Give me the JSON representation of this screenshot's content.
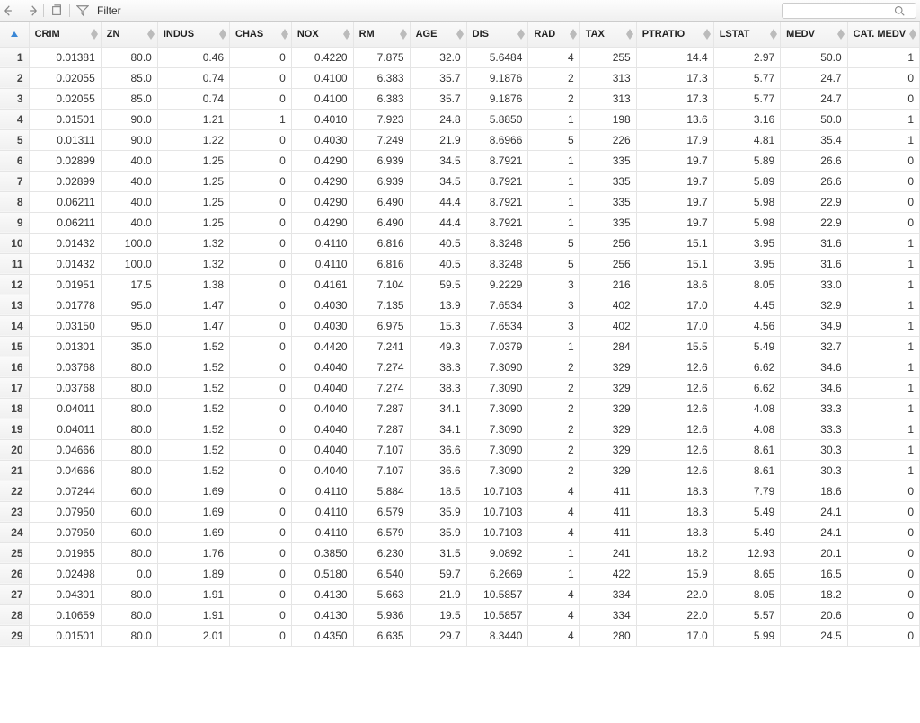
{
  "toolbar": {
    "filter_label": "Filter",
    "search_placeholder": ""
  },
  "columns": [
    {
      "key": "CRIM",
      "label": "CRIM",
      "cls": "col-crim"
    },
    {
      "key": "ZN",
      "label": "ZN",
      "cls": "col-zn"
    },
    {
      "key": "INDUS",
      "label": "INDUS",
      "cls": "col-indus"
    },
    {
      "key": "CHAS",
      "label": "CHAS",
      "cls": "col-chas"
    },
    {
      "key": "NOX",
      "label": "NOX",
      "cls": "col-nox"
    },
    {
      "key": "RM",
      "label": "RM",
      "cls": "col-rm"
    },
    {
      "key": "AGE",
      "label": "AGE",
      "cls": "col-age"
    },
    {
      "key": "DIS",
      "label": "DIS",
      "cls": "col-dis"
    },
    {
      "key": "RAD",
      "label": "RAD",
      "cls": "col-rad"
    },
    {
      "key": "TAX",
      "label": "TAX",
      "cls": "col-tax"
    },
    {
      "key": "PTRATIO",
      "label": "PTRATIO",
      "cls": "col-ptratio"
    },
    {
      "key": "LSTAT",
      "label": "LSTAT",
      "cls": "col-lstat"
    },
    {
      "key": "MEDV",
      "label": "MEDV",
      "cls": "col-medv"
    },
    {
      "key": "CAT_MEDV",
      "label": "CAT. MEDV",
      "cls": "col-cat"
    }
  ],
  "rows": [
    {
      "n": 1,
      "CRIM": "0.01381",
      "ZN": "80.0",
      "INDUS": "0.46",
      "CHAS": "0",
      "NOX": "0.4220",
      "RM": "7.875",
      "AGE": "32.0",
      "DIS": "5.6484",
      "RAD": "4",
      "TAX": "255",
      "PTRATIO": "14.4",
      "LSTAT": "2.97",
      "MEDV": "50.0",
      "CAT_MEDV": "1"
    },
    {
      "n": 2,
      "CRIM": "0.02055",
      "ZN": "85.0",
      "INDUS": "0.74",
      "CHAS": "0",
      "NOX": "0.4100",
      "RM": "6.383",
      "AGE": "35.7",
      "DIS": "9.1876",
      "RAD": "2",
      "TAX": "313",
      "PTRATIO": "17.3",
      "LSTAT": "5.77",
      "MEDV": "24.7",
      "CAT_MEDV": "0"
    },
    {
      "n": 3,
      "CRIM": "0.02055",
      "ZN": "85.0",
      "INDUS": "0.74",
      "CHAS": "0",
      "NOX": "0.4100",
      "RM": "6.383",
      "AGE": "35.7",
      "DIS": "9.1876",
      "RAD": "2",
      "TAX": "313",
      "PTRATIO": "17.3",
      "LSTAT": "5.77",
      "MEDV": "24.7",
      "CAT_MEDV": "0"
    },
    {
      "n": 4,
      "CRIM": "0.01501",
      "ZN": "90.0",
      "INDUS": "1.21",
      "CHAS": "1",
      "NOX": "0.4010",
      "RM": "7.923",
      "AGE": "24.8",
      "DIS": "5.8850",
      "RAD": "1",
      "TAX": "198",
      "PTRATIO": "13.6",
      "LSTAT": "3.16",
      "MEDV": "50.0",
      "CAT_MEDV": "1"
    },
    {
      "n": 5,
      "CRIM": "0.01311",
      "ZN": "90.0",
      "INDUS": "1.22",
      "CHAS": "0",
      "NOX": "0.4030",
      "RM": "7.249",
      "AGE": "21.9",
      "DIS": "8.6966",
      "RAD": "5",
      "TAX": "226",
      "PTRATIO": "17.9",
      "LSTAT": "4.81",
      "MEDV": "35.4",
      "CAT_MEDV": "1"
    },
    {
      "n": 6,
      "CRIM": "0.02899",
      "ZN": "40.0",
      "INDUS": "1.25",
      "CHAS": "0",
      "NOX": "0.4290",
      "RM": "6.939",
      "AGE": "34.5",
      "DIS": "8.7921",
      "RAD": "1",
      "TAX": "335",
      "PTRATIO": "19.7",
      "LSTAT": "5.89",
      "MEDV": "26.6",
      "CAT_MEDV": "0"
    },
    {
      "n": 7,
      "CRIM": "0.02899",
      "ZN": "40.0",
      "INDUS": "1.25",
      "CHAS": "0",
      "NOX": "0.4290",
      "RM": "6.939",
      "AGE": "34.5",
      "DIS": "8.7921",
      "RAD": "1",
      "TAX": "335",
      "PTRATIO": "19.7",
      "LSTAT": "5.89",
      "MEDV": "26.6",
      "CAT_MEDV": "0"
    },
    {
      "n": 8,
      "CRIM": "0.06211",
      "ZN": "40.0",
      "INDUS": "1.25",
      "CHAS": "0",
      "NOX": "0.4290",
      "RM": "6.490",
      "AGE": "44.4",
      "DIS": "8.7921",
      "RAD": "1",
      "TAX": "335",
      "PTRATIO": "19.7",
      "LSTAT": "5.98",
      "MEDV": "22.9",
      "CAT_MEDV": "0"
    },
    {
      "n": 9,
      "CRIM": "0.06211",
      "ZN": "40.0",
      "INDUS": "1.25",
      "CHAS": "0",
      "NOX": "0.4290",
      "RM": "6.490",
      "AGE": "44.4",
      "DIS": "8.7921",
      "RAD": "1",
      "TAX": "335",
      "PTRATIO": "19.7",
      "LSTAT": "5.98",
      "MEDV": "22.9",
      "CAT_MEDV": "0"
    },
    {
      "n": 10,
      "CRIM": "0.01432",
      "ZN": "100.0",
      "INDUS": "1.32",
      "CHAS": "0",
      "NOX": "0.4110",
      "RM": "6.816",
      "AGE": "40.5",
      "DIS": "8.3248",
      "RAD": "5",
      "TAX": "256",
      "PTRATIO": "15.1",
      "LSTAT": "3.95",
      "MEDV": "31.6",
      "CAT_MEDV": "1"
    },
    {
      "n": 11,
      "CRIM": "0.01432",
      "ZN": "100.0",
      "INDUS": "1.32",
      "CHAS": "0",
      "NOX": "0.4110",
      "RM": "6.816",
      "AGE": "40.5",
      "DIS": "8.3248",
      "RAD": "5",
      "TAX": "256",
      "PTRATIO": "15.1",
      "LSTAT": "3.95",
      "MEDV": "31.6",
      "CAT_MEDV": "1"
    },
    {
      "n": 12,
      "CRIM": "0.01951",
      "ZN": "17.5",
      "INDUS": "1.38",
      "CHAS": "0",
      "NOX": "0.4161",
      "RM": "7.104",
      "AGE": "59.5",
      "DIS": "9.2229",
      "RAD": "3",
      "TAX": "216",
      "PTRATIO": "18.6",
      "LSTAT": "8.05",
      "MEDV": "33.0",
      "CAT_MEDV": "1"
    },
    {
      "n": 13,
      "CRIM": "0.01778",
      "ZN": "95.0",
      "INDUS": "1.47",
      "CHAS": "0",
      "NOX": "0.4030",
      "RM": "7.135",
      "AGE": "13.9",
      "DIS": "7.6534",
      "RAD": "3",
      "TAX": "402",
      "PTRATIO": "17.0",
      "LSTAT": "4.45",
      "MEDV": "32.9",
      "CAT_MEDV": "1"
    },
    {
      "n": 14,
      "CRIM": "0.03150",
      "ZN": "95.0",
      "INDUS": "1.47",
      "CHAS": "0",
      "NOX": "0.4030",
      "RM": "6.975",
      "AGE": "15.3",
      "DIS": "7.6534",
      "RAD": "3",
      "TAX": "402",
      "PTRATIO": "17.0",
      "LSTAT": "4.56",
      "MEDV": "34.9",
      "CAT_MEDV": "1"
    },
    {
      "n": 15,
      "CRIM": "0.01301",
      "ZN": "35.0",
      "INDUS": "1.52",
      "CHAS": "0",
      "NOX": "0.4420",
      "RM": "7.241",
      "AGE": "49.3",
      "DIS": "7.0379",
      "RAD": "1",
      "TAX": "284",
      "PTRATIO": "15.5",
      "LSTAT": "5.49",
      "MEDV": "32.7",
      "CAT_MEDV": "1"
    },
    {
      "n": 16,
      "CRIM": "0.03768",
      "ZN": "80.0",
      "INDUS": "1.52",
      "CHAS": "0",
      "NOX": "0.4040",
      "RM": "7.274",
      "AGE": "38.3",
      "DIS": "7.3090",
      "RAD": "2",
      "TAX": "329",
      "PTRATIO": "12.6",
      "LSTAT": "6.62",
      "MEDV": "34.6",
      "CAT_MEDV": "1"
    },
    {
      "n": 17,
      "CRIM": "0.03768",
      "ZN": "80.0",
      "INDUS": "1.52",
      "CHAS": "0",
      "NOX": "0.4040",
      "RM": "7.274",
      "AGE": "38.3",
      "DIS": "7.3090",
      "RAD": "2",
      "TAX": "329",
      "PTRATIO": "12.6",
      "LSTAT": "6.62",
      "MEDV": "34.6",
      "CAT_MEDV": "1"
    },
    {
      "n": 18,
      "CRIM": "0.04011",
      "ZN": "80.0",
      "INDUS": "1.52",
      "CHAS": "0",
      "NOX": "0.4040",
      "RM": "7.287",
      "AGE": "34.1",
      "DIS": "7.3090",
      "RAD": "2",
      "TAX": "329",
      "PTRATIO": "12.6",
      "LSTAT": "4.08",
      "MEDV": "33.3",
      "CAT_MEDV": "1"
    },
    {
      "n": 19,
      "CRIM": "0.04011",
      "ZN": "80.0",
      "INDUS": "1.52",
      "CHAS": "0",
      "NOX": "0.4040",
      "RM": "7.287",
      "AGE": "34.1",
      "DIS": "7.3090",
      "RAD": "2",
      "TAX": "329",
      "PTRATIO": "12.6",
      "LSTAT": "4.08",
      "MEDV": "33.3",
      "CAT_MEDV": "1"
    },
    {
      "n": 20,
      "CRIM": "0.04666",
      "ZN": "80.0",
      "INDUS": "1.52",
      "CHAS": "0",
      "NOX": "0.4040",
      "RM": "7.107",
      "AGE": "36.6",
      "DIS": "7.3090",
      "RAD": "2",
      "TAX": "329",
      "PTRATIO": "12.6",
      "LSTAT": "8.61",
      "MEDV": "30.3",
      "CAT_MEDV": "1"
    },
    {
      "n": 21,
      "CRIM": "0.04666",
      "ZN": "80.0",
      "INDUS": "1.52",
      "CHAS": "0",
      "NOX": "0.4040",
      "RM": "7.107",
      "AGE": "36.6",
      "DIS": "7.3090",
      "RAD": "2",
      "TAX": "329",
      "PTRATIO": "12.6",
      "LSTAT": "8.61",
      "MEDV": "30.3",
      "CAT_MEDV": "1"
    },
    {
      "n": 22,
      "CRIM": "0.07244",
      "ZN": "60.0",
      "INDUS": "1.69",
      "CHAS": "0",
      "NOX": "0.4110",
      "RM": "5.884",
      "AGE": "18.5",
      "DIS": "10.7103",
      "RAD": "4",
      "TAX": "411",
      "PTRATIO": "18.3",
      "LSTAT": "7.79",
      "MEDV": "18.6",
      "CAT_MEDV": "0"
    },
    {
      "n": 23,
      "CRIM": "0.07950",
      "ZN": "60.0",
      "INDUS": "1.69",
      "CHAS": "0",
      "NOX": "0.4110",
      "RM": "6.579",
      "AGE": "35.9",
      "DIS": "10.7103",
      "RAD": "4",
      "TAX": "411",
      "PTRATIO": "18.3",
      "LSTAT": "5.49",
      "MEDV": "24.1",
      "CAT_MEDV": "0"
    },
    {
      "n": 24,
      "CRIM": "0.07950",
      "ZN": "60.0",
      "INDUS": "1.69",
      "CHAS": "0",
      "NOX": "0.4110",
      "RM": "6.579",
      "AGE": "35.9",
      "DIS": "10.7103",
      "RAD": "4",
      "TAX": "411",
      "PTRATIO": "18.3",
      "LSTAT": "5.49",
      "MEDV": "24.1",
      "CAT_MEDV": "0"
    },
    {
      "n": 25,
      "CRIM": "0.01965",
      "ZN": "80.0",
      "INDUS": "1.76",
      "CHAS": "0",
      "NOX": "0.3850",
      "RM": "6.230",
      "AGE": "31.5",
      "DIS": "9.0892",
      "RAD": "1",
      "TAX": "241",
      "PTRATIO": "18.2",
      "LSTAT": "12.93",
      "MEDV": "20.1",
      "CAT_MEDV": "0"
    },
    {
      "n": 26,
      "CRIM": "0.02498",
      "ZN": "0.0",
      "INDUS": "1.89",
      "CHAS": "0",
      "NOX": "0.5180",
      "RM": "6.540",
      "AGE": "59.7",
      "DIS": "6.2669",
      "RAD": "1",
      "TAX": "422",
      "PTRATIO": "15.9",
      "LSTAT": "8.65",
      "MEDV": "16.5",
      "CAT_MEDV": "0"
    },
    {
      "n": 27,
      "CRIM": "0.04301",
      "ZN": "80.0",
      "INDUS": "1.91",
      "CHAS": "0",
      "NOX": "0.4130",
      "RM": "5.663",
      "AGE": "21.9",
      "DIS": "10.5857",
      "RAD": "4",
      "TAX": "334",
      "PTRATIO": "22.0",
      "LSTAT": "8.05",
      "MEDV": "18.2",
      "CAT_MEDV": "0"
    },
    {
      "n": 28,
      "CRIM": "0.10659",
      "ZN": "80.0",
      "INDUS": "1.91",
      "CHAS": "0",
      "NOX": "0.4130",
      "RM": "5.936",
      "AGE": "19.5",
      "DIS": "10.5857",
      "RAD": "4",
      "TAX": "334",
      "PTRATIO": "22.0",
      "LSTAT": "5.57",
      "MEDV": "20.6",
      "CAT_MEDV": "0"
    },
    {
      "n": 29,
      "CRIM": "0.01501",
      "ZN": "80.0",
      "INDUS": "2.01",
      "CHAS": "0",
      "NOX": "0.4350",
      "RM": "6.635",
      "AGE": "29.7",
      "DIS": "8.3440",
      "RAD": "4",
      "TAX": "280",
      "PTRATIO": "17.0",
      "LSTAT": "5.99",
      "MEDV": "24.5",
      "CAT_MEDV": "0"
    }
  ]
}
